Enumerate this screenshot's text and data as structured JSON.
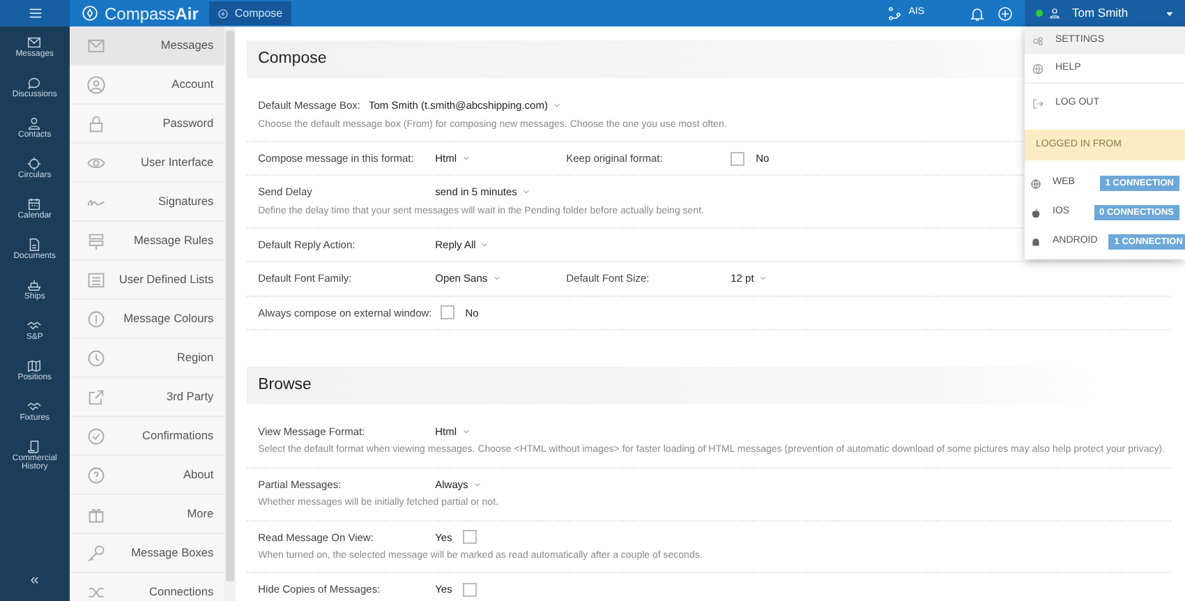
{
  "topbar": {
    "logo": "Compass**Air**",
    "tab": "Compose",
    "ais": "AIS",
    "user": "Tom Smith",
    "online": true
  },
  "rail": {
    "items": [
      {
        "label": "Messages"
      },
      {
        "label": "Discussions"
      },
      {
        "label": "Contacts"
      },
      {
        "label": "Circulars"
      },
      {
        "label": "Calendar"
      },
      {
        "label": "Documents"
      },
      {
        "label": "Ships"
      },
      {
        "label": "S&P"
      },
      {
        "label": "Positions"
      },
      {
        "label": "Fixtures"
      },
      {
        "label": "Commercial History"
      }
    ],
    "collapse": "«"
  },
  "settings_menu": [
    {
      "label": "Messages",
      "selected": true
    },
    {
      "label": "Account",
      "selected": false
    },
    {
      "label": "Password",
      "selected": false
    },
    {
      "label": "User Interface",
      "selected": false
    },
    {
      "label": "Signatures",
      "selected": false
    },
    {
      "label": "Message Rules",
      "selected": false
    },
    {
      "label": "User Defined Lists",
      "selected": false
    },
    {
      "label": "Message Colours",
      "selected": false
    },
    {
      "label": "Region",
      "selected": false
    },
    {
      "label": "3rd Party",
      "selected": false
    },
    {
      "label": "Confirmations",
      "selected": false
    },
    {
      "label": "About",
      "selected": false
    },
    {
      "label": "More",
      "selected": false
    },
    {
      "label": "Message Boxes",
      "selected": false
    },
    {
      "label": "Connections",
      "selected": false
    }
  ],
  "sections": [
    {
      "title": "Compose",
      "rows": [
        {
          "fields": [
            {
              "label": "Default Message Box:",
              "kind": "select",
              "value": "Tom Smith (t.smith@abcshipping.com)"
            }
          ],
          "description": "Choose the default message box (From) for composing new messages. Choose the one you use most often."
        },
        {
          "fields": [
            {
              "label": "Compose message in this format:",
              "kind": "select",
              "value": "Html"
            },
            {
              "label": "Keep original format:",
              "kind": "checkbox",
              "value": "No",
              "checked": false
            }
          ]
        },
        {
          "fields": [
            {
              "label": "Send Delay",
              "kind": "select",
              "value": "send in 5 minutes"
            }
          ],
          "description": "Define the delay time that your sent messages will wait in the Pending folder before actually being sent."
        },
        {
          "fields": [
            {
              "label": "Default Reply Action:",
              "kind": "select",
              "value": "Reply All"
            }
          ]
        },
        {
          "fields": [
            {
              "label": "Default Font Family:",
              "kind": "select",
              "value": "Open Sans"
            },
            {
              "label": "Default Font Size:",
              "kind": "select",
              "value": "12 pt"
            }
          ]
        },
        {
          "fields": [
            {
              "label": "Always compose on external window:",
              "kind": "checkbox",
              "value": "No",
              "checked": false
            }
          ]
        }
      ]
    },
    {
      "title": "Browse",
      "rows": [
        {
          "fields": [
            {
              "label": "View Message Format:",
              "kind": "select",
              "value": "Html"
            }
          ],
          "description": "Select the default format when viewing messages. Choose <HTML without images> for faster loading of HTML messages (prevention of automatic download of some pictures may also help protect your privacy)."
        },
        {
          "fields": [
            {
              "label": "Partial Messages:",
              "kind": "select",
              "value": "Always"
            }
          ],
          "description": "Whether messages will be initially fetched partial or not."
        },
        {
          "fields": [
            {
              "label": "Read Message On View:",
              "kind": "text-checkbox",
              "value": "Yes",
              "checked": false
            }
          ],
          "description": "When turned on, the selected message will be marked as read automatically after a couple of seconds."
        },
        {
          "fields": [
            {
              "label": "Hide Copies of Messages:",
              "kind": "text-checkbox",
              "value": "Yes",
              "checked": false
            }
          ]
        }
      ]
    }
  ],
  "user_menu": {
    "items": [
      {
        "label": "SETTINGS",
        "selected": true
      },
      {
        "label": "HELP",
        "selected": false
      },
      {
        "label": "LOG OUT",
        "selected": false
      }
    ],
    "logged_in_header": "LOGGED IN FROM",
    "connections": [
      {
        "platform": "WEB",
        "count": "1 CONNECTION"
      },
      {
        "platform": "IOS",
        "count": "0 CONNECTIONS"
      },
      {
        "platform": "ANDROID",
        "count": "1 CONNECTION"
      }
    ]
  }
}
